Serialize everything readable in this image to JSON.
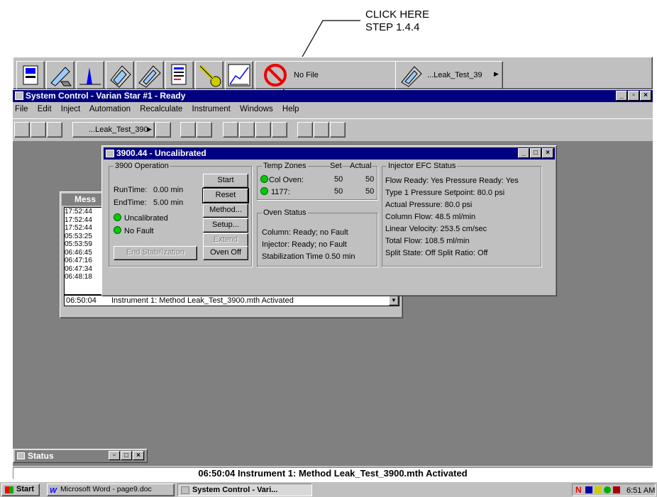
{
  "annotation": {
    "line1": "CLICK HERE",
    "line2": "STEP 1.4.4"
  },
  "toolbar_top": {
    "icons": [
      "instrument-icon",
      "method-edit-icon",
      "chromatogram-icon",
      "sample-list-icon",
      "sequence-icon",
      "report-icon",
      "security-key-icon",
      "calibration-icon"
    ],
    "no_file_label": "No File",
    "method_label": "...Leak_Test_39"
  },
  "app": {
    "title": "System Control - Varian Star #1 - Ready",
    "menu": [
      "File",
      "Edit",
      "Inject",
      "Automation",
      "Recalculate",
      "Instrument",
      "Windows",
      "Help"
    ],
    "toolbar_method": "...Leak_Test_390"
  },
  "dialog": {
    "title": "3900.44 - Uncalibrated",
    "operation": {
      "caption": "3900 Operation",
      "runtime_label": "RunTime:",
      "runtime_value": "0.00 min",
      "endtime_label": "EndTime:",
      "endtime_value": "5.00 min",
      "status1": "Uncalibrated",
      "status2": "No Fault",
      "end_stab": "End Stabilization"
    },
    "buttons": {
      "start": "Start",
      "reset": "Reset",
      "method": "Method...",
      "setup": "Setup...",
      "extend": "Extend",
      "oven_off": "Oven Off"
    },
    "temp_zones": {
      "caption": "Temp Zones",
      "set": "Set",
      "actual": "Actual",
      "rows": [
        {
          "name": "Col Oven:",
          "set": "50",
          "actual": "50"
        },
        {
          "name": "1177:",
          "set": "50",
          "actual": "50"
        }
      ]
    },
    "oven_status": {
      "caption": "Oven Status",
      "lines": [
        "Column: Ready; no Fault",
        "Injector: Ready; no Fault",
        "Stabilization Time 0.50 min"
      ]
    },
    "injector": {
      "caption": "Injector EFC Status",
      "lines": [
        "Flow Ready: Yes  Pressure Ready: Yes",
        "Type 1 Pressure Setpoint:  80.0 psi",
        "Actual Pressure:  80.0 psi",
        "Column Flow: 48.5 ml/min",
        "Linear Velocity: 253.5 cm/sec",
        "Total Flow: 108.5 ml/min",
        "Split State: Off   Split Ratio: Off"
      ]
    }
  },
  "messages": {
    "title": "Mess",
    "times": [
      "17:52:44",
      "17:52:44",
      "17:52:44",
      "05:53:25",
      "05:53:59",
      "06:46:45",
      "06:47:16",
      "06:47:34",
      "06:48:18"
    ],
    "current_time": "06:50:04",
    "current_text": "Instrument 1:  Method Leak_Test_3900.mth Activated"
  },
  "status_window": {
    "title": "Status"
  },
  "status_bar": {
    "text": "06:50:04   Instrument 1:  Method Leak_Test_3900.mth Activated"
  },
  "taskbar": {
    "start": "Start",
    "tasks": [
      "Microsoft Word - page9.doc",
      "System Control - Vari..."
    ],
    "clock": "6:51 AM"
  },
  "colors": {
    "desktop": "#808080",
    "title": "#000080",
    "face": "#c0c0c0",
    "led": "#00cc00",
    "stop": "#e00000"
  }
}
